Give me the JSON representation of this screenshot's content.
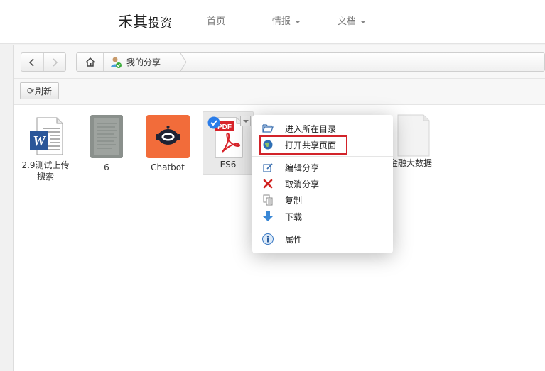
{
  "header": {
    "brand_main": "禾其",
    "brand_sub": "投资",
    "nav": [
      {
        "label": "首页",
        "dropdown": false
      },
      {
        "label": "情报",
        "dropdown": true
      },
      {
        "label": "文档",
        "dropdown": true
      }
    ]
  },
  "breadcrumb": {
    "current": "我的分享"
  },
  "toolbar": {
    "refresh_label": "刷新"
  },
  "files": [
    {
      "name": "2.9测试上传搜索",
      "name_line1": "2.9测试上传",
      "name_line2": "搜索",
      "type": "word"
    },
    {
      "name": "6",
      "type": "image"
    },
    {
      "name": "Chatbot",
      "type": "app"
    },
    {
      "name": "ES6",
      "type": "pdf",
      "selected": true
    },
    {
      "name": "金融大数据",
      "type": "document"
    }
  ],
  "context_menu": {
    "items": [
      {
        "label": "进入所在目录",
        "icon": "folder-open-icon"
      },
      {
        "label": "打开共享页面",
        "icon": "globe-icon",
        "highlighted": true
      },
      {
        "label": "编辑分享",
        "icon": "edit-icon"
      },
      {
        "label": "取消分享",
        "icon": "close-icon"
      },
      {
        "label": "复制",
        "icon": "copy-icon"
      },
      {
        "label": "下载",
        "icon": "download-icon"
      },
      {
        "label": "属性",
        "icon": "info-icon"
      }
    ]
  },
  "colors": {
    "highlight_border": "#d2232a",
    "chatbot_tile": "#f26c3a",
    "pdf_red": "#d8232a",
    "word_blue": "#2a5699",
    "check_blue": "#2b7de9"
  }
}
